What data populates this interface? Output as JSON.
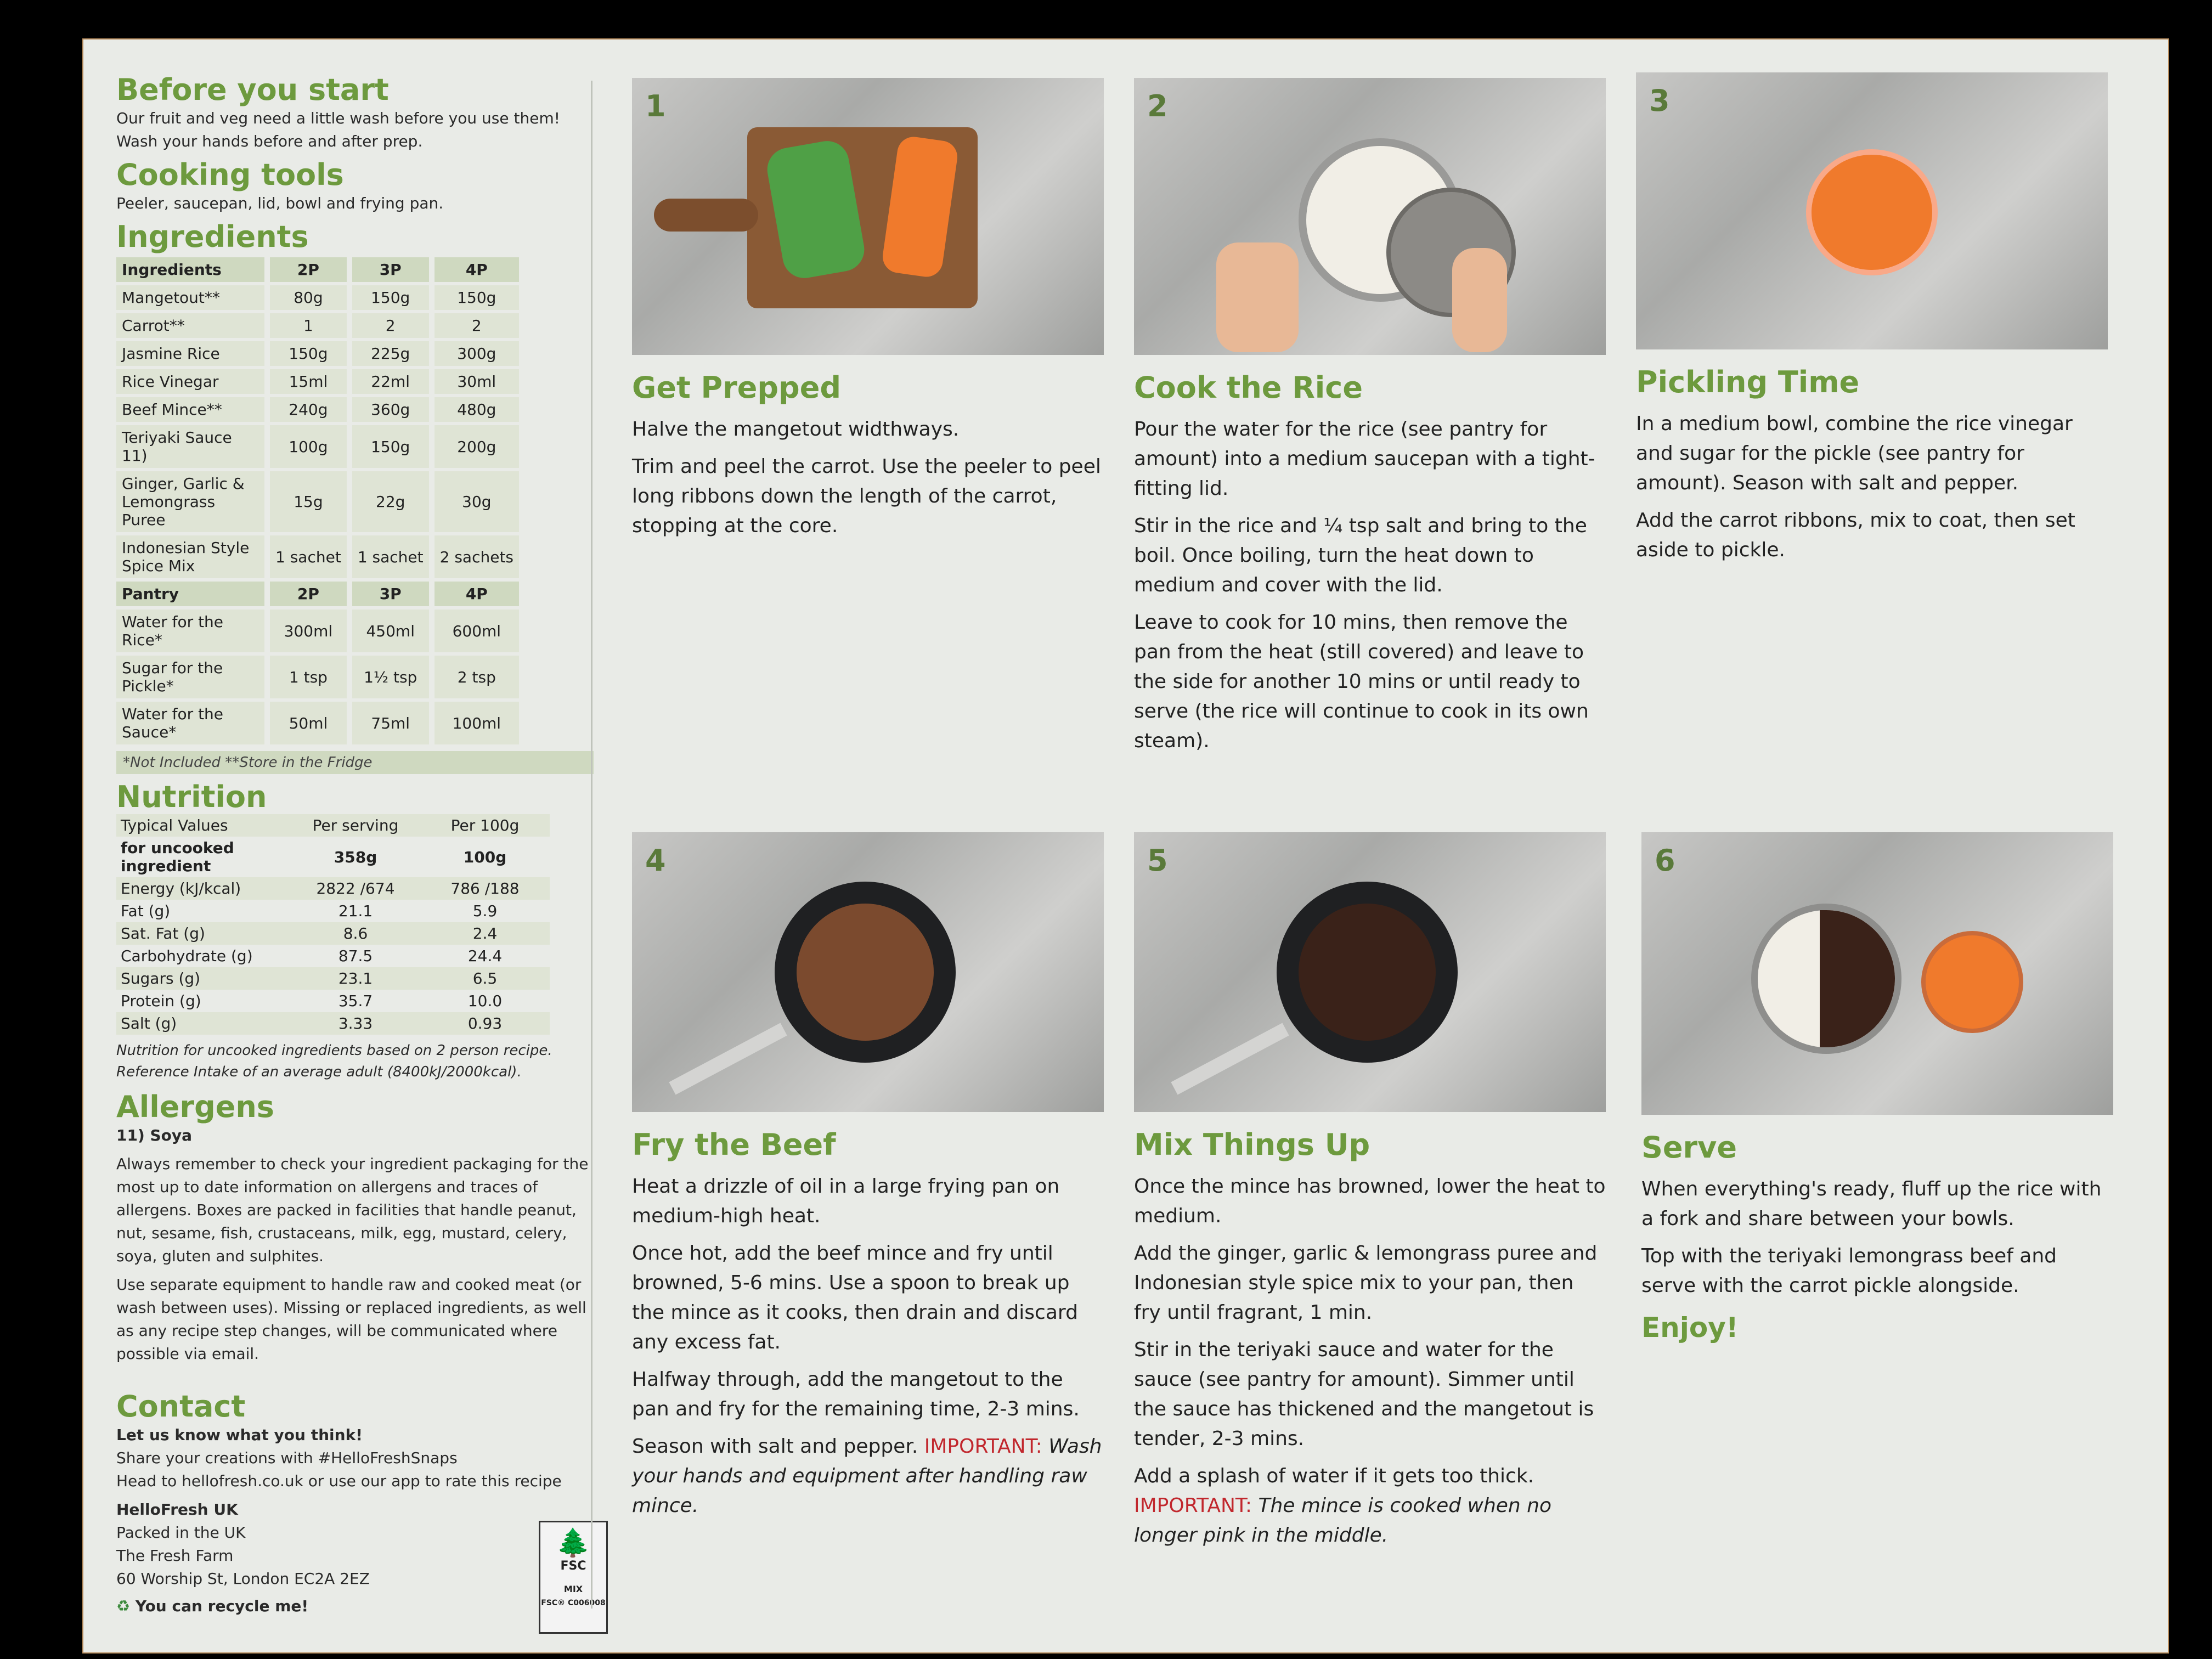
{
  "before": {
    "title": "Before you start",
    "text": "Our fruit and veg need a little wash before you use them! Wash your hands before and after prep."
  },
  "tools": {
    "title": "Cooking tools",
    "text": "Peeler, saucepan, lid, bowl and frying pan."
  },
  "ingredients": {
    "title": "Ingredients",
    "header": [
      "Ingredients",
      "2P",
      "3P",
      "4P"
    ],
    "rows": [
      [
        "Mangetout**",
        "80g",
        "150g",
        "150g"
      ],
      [
        "Carrot**",
        "1",
        "2",
        "2"
      ],
      [
        "Jasmine Rice",
        "150g",
        "225g",
        "300g"
      ],
      [
        "Rice Vinegar",
        "15ml",
        "22ml",
        "30ml"
      ],
      [
        "Beef Mince**",
        "240g",
        "360g",
        "480g"
      ],
      [
        "Teriyaki Sauce 11)",
        "100g",
        "150g",
        "200g"
      ],
      [
        "Ginger, Garlic & Lemongrass Puree",
        "15g",
        "22g",
        "30g"
      ],
      [
        "Indonesian Style Spice Mix",
        "1 sachet",
        "1 sachet",
        "2 sachets"
      ]
    ],
    "pantry_header": [
      "Pantry",
      "2P",
      "3P",
      "4P"
    ],
    "pantry_rows": [
      [
        "Water for the Rice*",
        "300ml",
        "450ml",
        "600ml"
      ],
      [
        "Sugar for the Pickle*",
        "1 tsp",
        "1½ tsp",
        "2 tsp"
      ],
      [
        "Water for the Sauce*",
        "50ml",
        "75ml",
        "100ml"
      ]
    ],
    "footnote": "*Not Included  **Store in the Fridge"
  },
  "nutrition": {
    "title": "Nutrition",
    "header": [
      "Typical Values",
      "Per serving",
      "Per 100g"
    ],
    "rows": [
      [
        "for uncooked ingredient",
        "358g",
        "100g"
      ],
      [
        "Energy (kJ/kcal)",
        "2822 /674",
        "786 /188"
      ],
      [
        "Fat (g)",
        "21.1",
        "5.9"
      ],
      [
        "Sat. Fat (g)",
        "8.6",
        "2.4"
      ],
      [
        "Carbohydrate (g)",
        "87.5",
        "24.4"
      ],
      [
        "Sugars (g)",
        "23.1",
        "6.5"
      ],
      [
        "Protein (g)",
        "35.7",
        "10.0"
      ],
      [
        "Salt (g)",
        "3.33",
        "0.93"
      ]
    ],
    "note": "Nutrition for uncooked ingredients based on 2 person recipe. Reference Intake of an average adult (8400kJ/2000kcal)."
  },
  "allergens": {
    "title": "Allergens",
    "item": "11) Soya",
    "p1": "Always remember to check your ingredient packaging for the most up to date information on allergens and traces of allergens. Boxes are packed in facilities that handle peanut, nut, sesame, fish, crustaceans, milk, egg, mustard, celery, soya, gluten and sulphites.",
    "p2": "Use separate equipment to handle raw and cooked meat (or wash between uses). Missing or replaced ingredients, as well as any recipe step changes, will be communicated where possible via email."
  },
  "contact": {
    "title": "Contact",
    "l1": "Let us know what you think!",
    "l2": "Share your creations with #HelloFreshSnaps",
    "l3": "Head to hellofresh.co.uk or use our app to rate this recipe",
    "a1": "HelloFresh UK",
    "a2": "Packed in the UK",
    "a3": "The Fresh Farm",
    "a4": "60 Worship St, London EC2A 2EZ",
    "recycle": "You can recycle me!",
    "fsc_label": "FSC",
    "fsc_mix": "MIX",
    "fsc_code": "FSC® C006008"
  },
  "steps": [
    {
      "num": "1",
      "title": "Get Prepped",
      "paras": [
        "Halve the mangetout widthways.",
        "Trim and peel the carrot. Use the peeler to peel long ribbons down the length of the carrot, stopping at the core."
      ]
    },
    {
      "num": "2",
      "title": "Cook the Rice",
      "paras": [
        "Pour the water for the rice (see pantry for amount) into a medium saucepan with a tight-fitting lid.",
        "Stir in the rice and ¼ tsp salt and bring to the boil. Once boiling, turn the heat down to medium and cover with the lid.",
        "Leave to cook for 10 mins, then remove the pan from the heat (still covered) and leave to the side for another 10 mins or until ready to serve (the rice will continue to cook in its own steam)."
      ]
    },
    {
      "num": "3",
      "title": "Pickling Time",
      "paras": [
        "In a medium bowl, combine the rice vinegar and sugar for the pickle (see pantry for amount). Season with salt and pepper.",
        "Add the carrot ribbons, mix to coat, then set aside to pickle."
      ]
    },
    {
      "num": "4",
      "title": "Fry the Beef",
      "paras": [
        "Heat a drizzle of oil in a large frying pan on medium-high heat.",
        "Once hot, add the beef mince and fry until browned, 5-6 mins. Use a spoon to break up the mince as it cooks, then drain and discard any excess fat.",
        "Halfway through, add the mangetout to the pan and fry for the remaining time, 2-3 mins.",
        "Season with salt and pepper."
      ],
      "important": "IMPORTANT:",
      "important_text": "Wash your hands and equipment after handling raw mince."
    },
    {
      "num": "5",
      "title": "Mix Things Up",
      "paras": [
        "Once the mince has browned, lower the heat to medium.",
        "Add the ginger, garlic & lemongrass puree and Indonesian style spice mix to your pan, then fry until fragrant, 1 min.",
        "Stir in the teriyaki sauce and water for the sauce (see pantry for amount). Simmer until the sauce has thickened and the mangetout is tender, 2-3 mins.",
        "Add a splash of water if it gets too thick."
      ],
      "important": "IMPORTANT:",
      "important_text": "The mince is cooked when no longer pink in the middle."
    },
    {
      "num": "6",
      "title": "Serve",
      "paras": [
        "When everything's ready, fluff up the rice with a fork and share between your bowls.",
        "Top with the teriyaki lemongrass beef and serve with the carrot pickle alongside."
      ],
      "enjoy": "Enjoy!"
    }
  ]
}
